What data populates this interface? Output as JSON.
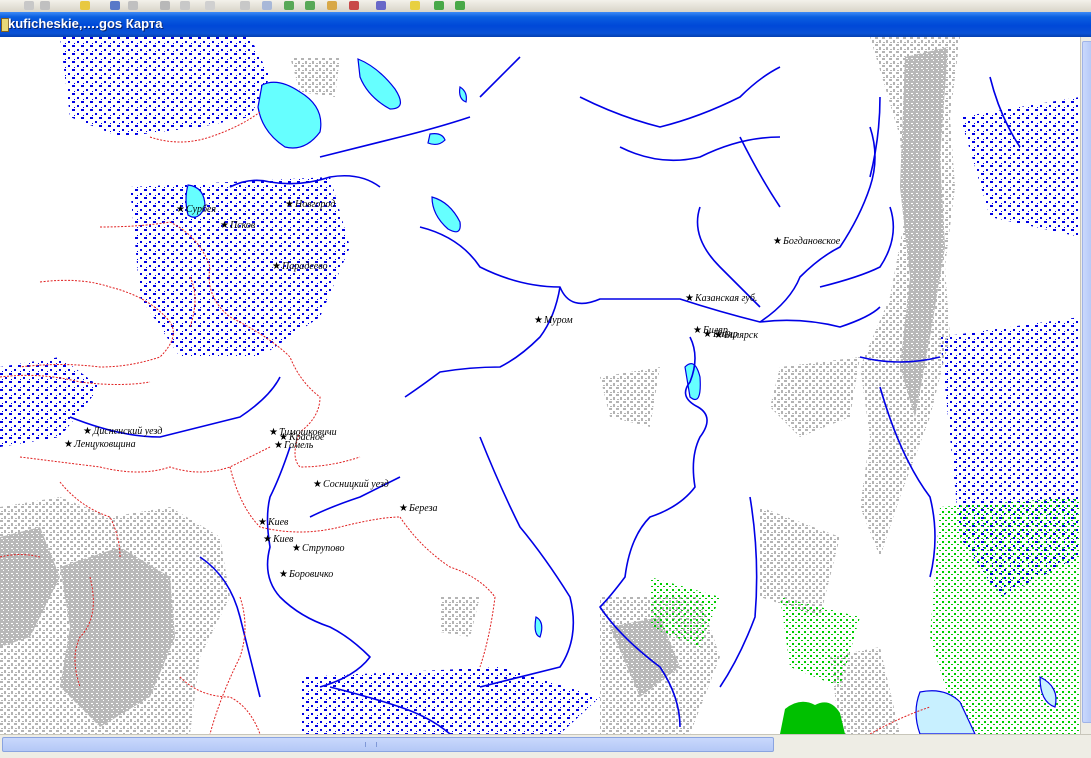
{
  "window": {
    "title": "kuficheskie,….gos Карта"
  },
  "map": {
    "colors": {
      "water": "#0000e6",
      "lake_fill": "#66ffff",
      "border": "#e02020",
      "mountains": "#b4b4b4",
      "vegetation": "#00cc00"
    },
    "places": [
      {
        "id": "izborsk",
        "label": "Сурбея"
      },
      {
        "id": "novgorod",
        "label": "Новгород"
      },
      {
        "id": "pskov",
        "label": "Псков"
      },
      {
        "id": "paradeevo",
        "label": "Парадеево"
      },
      {
        "id": "bogdanovskoe",
        "label": "Богдановское"
      },
      {
        "id": "kazanskaya",
        "label": "Казанская губ."
      },
      {
        "id": "murom",
        "label": "Муром"
      },
      {
        "id": "bilyarsk",
        "label": "Биляр"
      },
      {
        "id": "bilyarsk2",
        "label": "Биляр"
      },
      {
        "id": "bilyarsk3",
        "label": "Билярск"
      },
      {
        "id": "disna",
        "label": "Дисненский уезд"
      },
      {
        "id": "lenchukovschina",
        "label": "Ленцуковщина"
      },
      {
        "id": "timoschkovichi",
        "label": "Тимошковичи"
      },
      {
        "id": "krasnoe",
        "label": "Красное"
      },
      {
        "id": "gomel",
        "label": "Гомель"
      },
      {
        "id": "sosnitsky",
        "label": "Сосницкий уезд"
      },
      {
        "id": "bereza",
        "label": "Береза"
      },
      {
        "id": "kiev",
        "label": "Киев"
      },
      {
        "id": "kiev2",
        "label": "Киев"
      },
      {
        "id": "strupovo",
        "label": "Струпово"
      },
      {
        "id": "borovichi",
        "label": "Боровичко"
      }
    ]
  }
}
